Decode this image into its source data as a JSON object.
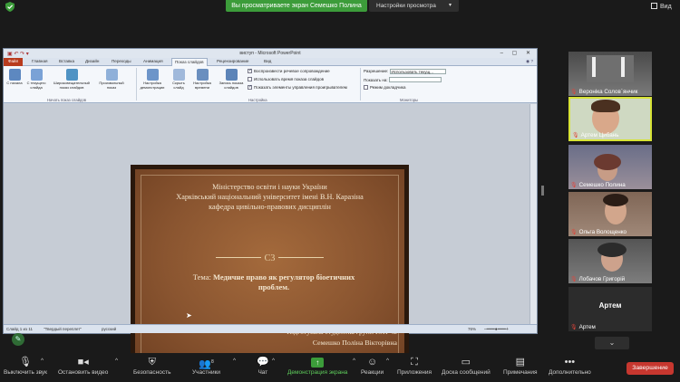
{
  "top": {
    "share_banner": "Вы просматриваете экран Семешко Полина",
    "view_options": "Настройки просмотра",
    "view_button": "Вид"
  },
  "ppt": {
    "title": "виступ - Microsoft PowerPoint",
    "tabs": [
      "Файл",
      "Главная",
      "Вставка",
      "Дизайн",
      "Переходы",
      "Анимация",
      "Показ слайдов",
      "Рецензирование",
      "Вид"
    ],
    "buttons": {
      "from_start": "С начала",
      "from_current": "С текущего слайда",
      "broadcast": "Широковещательный показ слайдов",
      "custom": "Произвольный показ",
      "setup": "Настройка демонстрации",
      "hide": "Скрыть слайд",
      "rehearse": "Настройка времени",
      "record": "Запись показа слайдов"
    },
    "groups": {
      "start": "Начать показ слайдов",
      "setup": "Настройка",
      "monitors": "Мониторы"
    },
    "checks": [
      {
        "label": "Воспроизвести речевое сопровождение",
        "on": true
      },
      {
        "label": "Использовать время показа слайдов",
        "on": false
      },
      {
        "label": "Показать элементы управления проигрывателем",
        "on": true
      }
    ],
    "monitors": {
      "resolution_label": "Разрешение:",
      "resolution_value": "Использовать текущ...",
      "show_on_label": "Показать на:",
      "presenter_label": "Режим докладчика"
    },
    "status": {
      "slide": "Слайд 1 из 11",
      "theme": "\"Твердый переплет\"",
      "lang": "русский",
      "zoom": "76%"
    }
  },
  "slide": {
    "line1": "Міністерство освіти і науки України",
    "line2": "Харківський національний університет імені  В.Н. Каразіна",
    "line3": "кафедра цивільно-правових дисциплін",
    "ornament": "C3",
    "topic_label": "Тема: ",
    "topic_bold_1": "Медичне право як регулятор біоетичних",
    "topic_bold_2": "проблем.",
    "author_1": "Підготувала студентка групи ЮП-42",
    "author_2": "Семешко Поліна Вікторівна"
  },
  "participants": [
    {
      "name": "Вероніка Солов`янчик",
      "muted": true
    },
    {
      "name": "Артем Цибань",
      "muted": true,
      "active": true
    },
    {
      "name": "Семешко Полина",
      "muted": true
    },
    {
      "name": "Ольга Волощенко",
      "muted": true
    },
    {
      "name": "Лобачов Григорій",
      "muted": true
    },
    {
      "name": "Артем",
      "muted": true,
      "initials": "Артем"
    }
  ],
  "toolbar": {
    "mute": "Выключить звук",
    "video": "Остановить видео",
    "security": "Безопасность",
    "participants": "Участники",
    "participants_count": "8",
    "chat": "Чат",
    "share": "Демонстрация экрана",
    "reactions": "Реакции",
    "apps": "Приложения",
    "breakout": "Доска сообщений",
    "notes": "Примечания",
    "more": "Дополнительно",
    "end": "Завершение"
  },
  "colors": {
    "share_green": "#3c9c3a",
    "end_red": "#c7372f",
    "active_border": "#d7e336",
    "slide_brown": "#8a5530"
  }
}
